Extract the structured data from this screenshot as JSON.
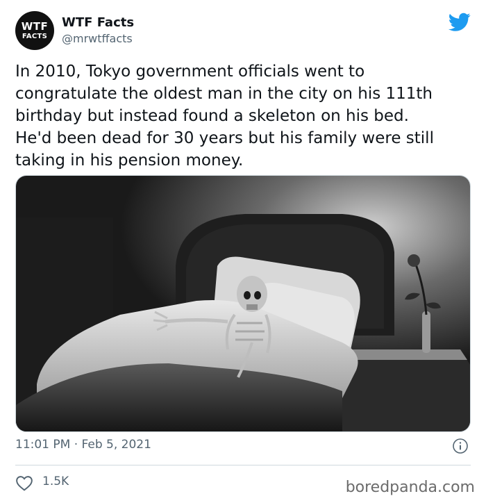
{
  "author": {
    "avatar_line1": "WTF",
    "avatar_line2": "FACTS",
    "display_name": "WTF Facts",
    "handle": "@mrwtffacts"
  },
  "tweet": {
    "text": "In 2010, Tokyo government officials went to\ncongratulate the oldest man in the city on his 111th\nbirthday but instead found a skeleton on his bed.\nHe'd been dead for 30 years but his family were still\ntaking in his pension money.",
    "timestamp": "11:01 PM · Feb 5, 2021",
    "like_count": "1.5K"
  },
  "icons": {
    "brand": "twitter-bird-icon",
    "info": "info-icon",
    "like": "heart-icon"
  },
  "colors": {
    "twitter_blue": "#1d9bf0",
    "secondary_text": "#536471",
    "divider": "#cfd9de"
  },
  "watermark": "boredpanda.com"
}
